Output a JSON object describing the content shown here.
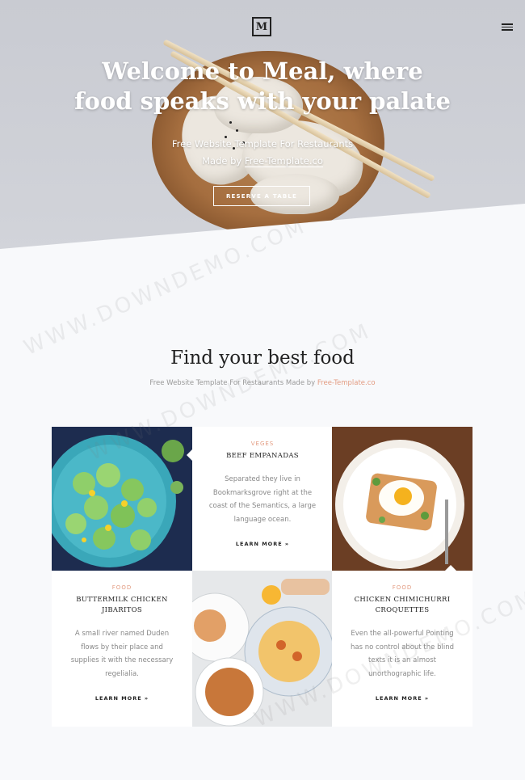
{
  "nav": {
    "logo_letter": "M",
    "menu_icon": "hamburger-icon"
  },
  "hero": {
    "title_line1": "Welcome to Meal, where",
    "title_line2": "food speaks with your palate",
    "sub_line1": "Free Website Template For Restaurants",
    "sub_prefix": "Made by ",
    "sub_link": "Free-Template.co",
    "button": "RESERVE A TABLE"
  },
  "section": {
    "title": "Find your best food",
    "sub_prefix": "Free Website Template For Restaurants Made by ",
    "sub_link": "Free-Template.co"
  },
  "cards": [
    {
      "category": "VEGES",
      "name": "BEEF EMPANADAS",
      "desc": "Separated they live in Bookmarksgrove right at the coast of the Semantics, a large language ocean.",
      "more": "LEARN MORE »"
    },
    {
      "category": "FOOD",
      "name": "BUTTERMILK CHICKEN JIBARITOS",
      "desc": "A small river named Duden flows by their place and supplies it with the necessary regelialia.",
      "more": "LEARN MORE »"
    },
    {
      "category": "FOOD",
      "name": "CHICKEN CHIMICHURRI CROQUETTES",
      "desc": "Even the all-powerful Pointing has no control about the blind texts it is an almost unorthographic life.",
      "more": "LEARN MORE »"
    }
  ],
  "watermark": "WWW.DOWNDEMO.COM",
  "colors": {
    "accent": "#e39c82",
    "background": "#f8f9fb",
    "heading": "#222222"
  }
}
